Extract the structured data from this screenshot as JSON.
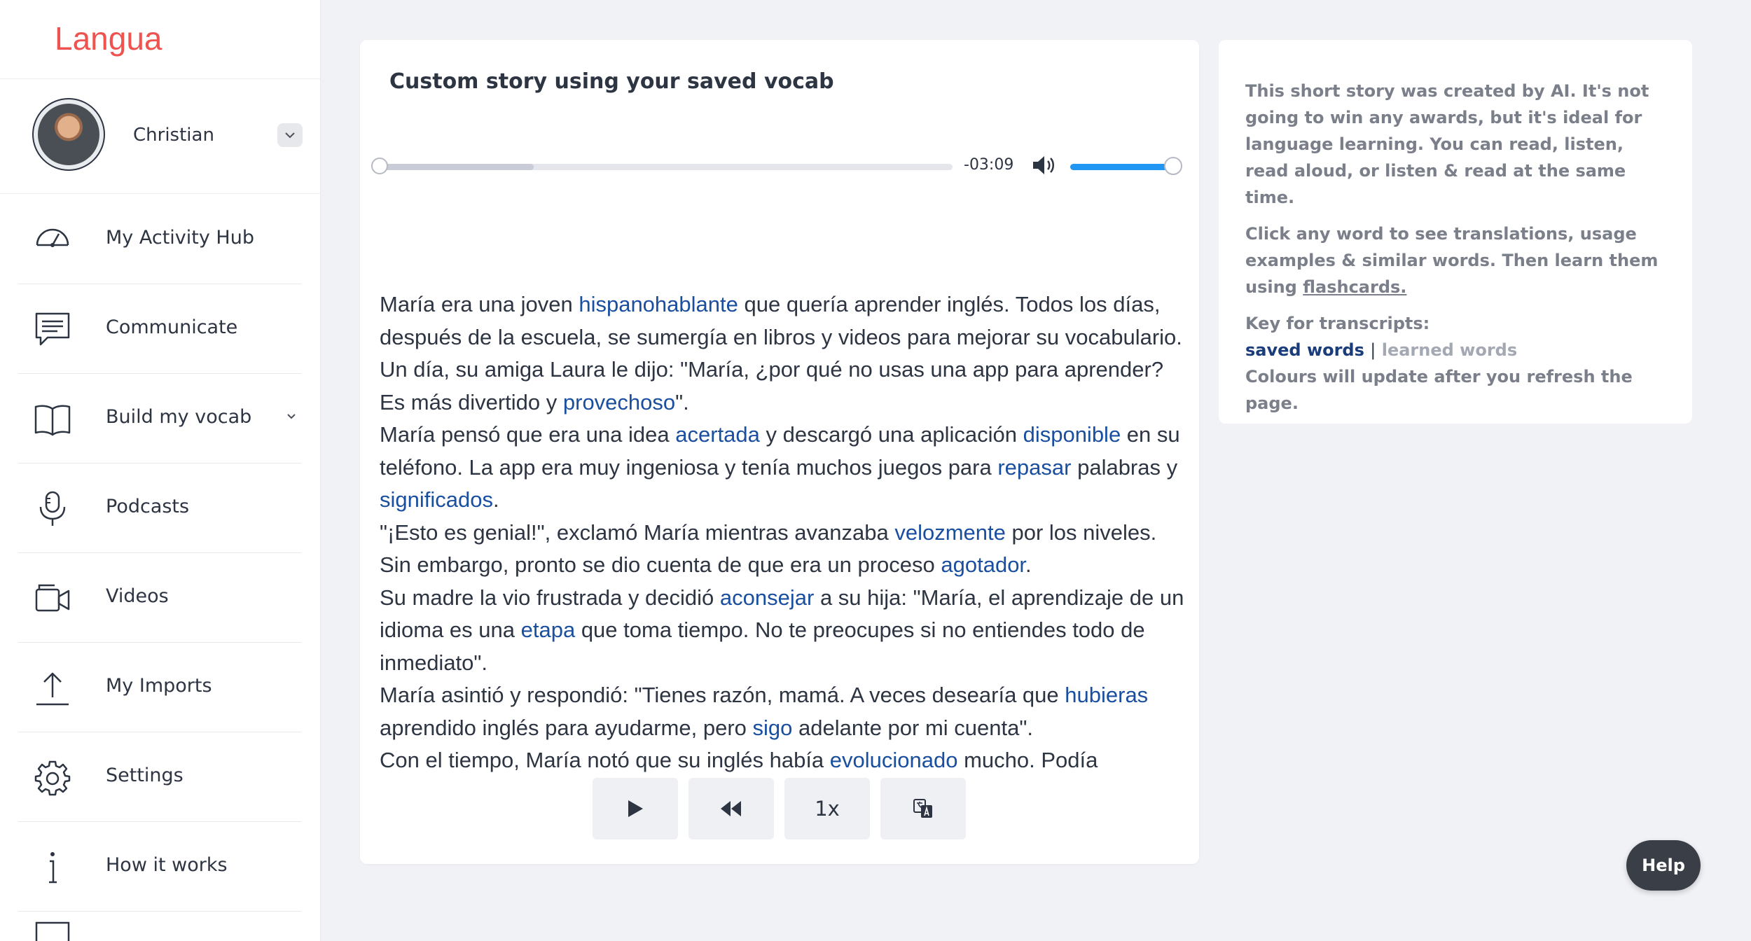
{
  "app": {
    "logo_text": "Langua",
    "brand_color": "#ef5350"
  },
  "profile": {
    "name": "Christian"
  },
  "sidebar": {
    "items": [
      {
        "label": "My Activity Hub",
        "icon": "speedometer-icon"
      },
      {
        "label": "Communicate",
        "icon": "chat-icon"
      },
      {
        "label": "Build my vocab",
        "icon": "book-icon",
        "has_submenu": true
      },
      {
        "label": "Podcasts",
        "icon": "microphone-icon"
      },
      {
        "label": "Videos",
        "icon": "video-camera-icon"
      },
      {
        "label": "My Imports",
        "icon": "upload-icon"
      },
      {
        "label": "Settings",
        "icon": "gear-icon"
      },
      {
        "label": "How it works",
        "icon": "info-icon"
      }
    ]
  },
  "player": {
    "title": "Custom story using your saved vocab",
    "time_remaining": "-03:09",
    "volume_percent": 100,
    "speed_label": "1x",
    "accent_color": "#2196f3"
  },
  "story": {
    "saved_word_color": "#1a4fa0",
    "paragraphs": [
      [
        {
          "t": "María era una joven "
        },
        {
          "t": "hispanohablante",
          "saved": true
        },
        {
          "t": " que quería aprender inglés. Todos los días, después de la escuela, se sumergía en libros y videos para mejorar su vocabulario."
        }
      ],
      [
        {
          "t": "Un día, su amiga Laura le dijo: \"María, ¿por qué no usas una app para aprender? Es más divertido y "
        },
        {
          "t": "provechoso",
          "saved": true
        },
        {
          "t": "\"."
        }
      ],
      [
        {
          "t": "María pensó que era una idea "
        },
        {
          "t": "acertada",
          "saved": true
        },
        {
          "t": " y descargó una aplicación "
        },
        {
          "t": "disponible",
          "saved": true
        },
        {
          "t": " en su teléfono. La app era muy ingeniosa y tenía muchos juegos para "
        },
        {
          "t": "repasar",
          "saved": true
        },
        {
          "t": " palabras y "
        },
        {
          "t": "significados",
          "saved": true
        },
        {
          "t": "."
        }
      ],
      [
        {
          "t": "\"¡Esto es genial!\", exclamó María mientras avanzaba "
        },
        {
          "t": "velozmente",
          "saved": true
        },
        {
          "t": " por los niveles. Sin embargo, pronto se dio cuenta de que era un proceso "
        },
        {
          "t": "agotador",
          "saved": true
        },
        {
          "t": "."
        }
      ],
      [
        {
          "t": "Su madre la vio frustrada y decidió "
        },
        {
          "t": "aconsejar",
          "saved": true
        },
        {
          "t": " a su hija: \"María, el aprendizaje de un idioma es una "
        },
        {
          "t": "etapa",
          "saved": true
        },
        {
          "t": " que toma tiempo. No te preocupes si no entiendes todo de inmediato\"."
        }
      ],
      [
        {
          "t": "María asintió y respondió: \"Tienes razón, mamá. A veces desearía que "
        },
        {
          "t": "hubieras",
          "saved": true
        },
        {
          "t": " aprendido inglés para ayudarme, pero "
        },
        {
          "t": "sigo",
          "saved": true
        },
        {
          "t": " adelante por mi cuenta\"."
        }
      ],
      [
        {
          "t": "Con el tiempo, María notó que su inglés había "
        },
        {
          "t": "evolucionado",
          "saved": true
        },
        {
          "t": " mucho. Podía"
        }
      ]
    ]
  },
  "info": {
    "intro": "This short story was created by AI. It's not going to win any awards, but it's ideal for language learning. You can read, listen, read aloud, or listen & read at the same time.",
    "click_text": "Click any word to see translations, usage examples & similar words. Then learn them using ",
    "flashcards_link": "flashcards.",
    "key_heading": "Key for transcripts:",
    "key_saved": "saved words",
    "key_separator": "|",
    "key_learned": "learned words",
    "refresh_note": "Colours will update after you refresh the page."
  },
  "help": {
    "label": "Help"
  }
}
